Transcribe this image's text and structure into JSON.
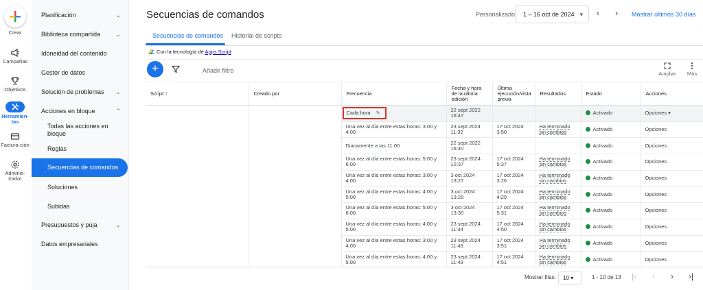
{
  "rail": {
    "create": "Crear",
    "items": [
      "Campañas",
      "Objetivos",
      "Herramien-tas",
      "Factura-ción",
      "Adminis-trador"
    ]
  },
  "sidenav": {
    "items": [
      {
        "label": "Planificación"
      },
      {
        "label": "Biblioteca compartida"
      },
      {
        "label": "Idoneidad del contenido"
      },
      {
        "label": "Gestor de datos"
      },
      {
        "label": "Solución de problemas"
      },
      {
        "label": "Acciones en bloque"
      },
      {
        "label": "Todas las acciones en bloque"
      },
      {
        "label": "Reglas"
      },
      {
        "label": "Secuencias de comandos"
      },
      {
        "label": "Soluciones"
      },
      {
        "label": "Subidas"
      },
      {
        "label": "Presupuestos y puja"
      },
      {
        "label": "Datos empresariales"
      }
    ]
  },
  "header": {
    "title": "Secuencias de comandos",
    "period_label": "Personalizado",
    "date_range": "1 – 16 oct de 2024",
    "show_last": "Mostrar últimos 30 días"
  },
  "tabs": [
    "Secuencias de comandos",
    "Historial de scripts"
  ],
  "powered": {
    "prefix": "Con la tecnología de",
    "link": "Apps Script"
  },
  "toolbar": {
    "add_filter": "Añadir filtro",
    "expand": "Ampliar",
    "more": "Más"
  },
  "table": {
    "columns": [
      "Script",
      "Creado por",
      "Frecuencia",
      "Fecha y hora de la última edición",
      "Última ejecución/vista previa",
      "Resultados",
      "Estado",
      "Acciones"
    ],
    "rows": [
      {
        "freq": "Cada hora",
        "edited": "22 sept 2022 16:47",
        "last_run": "",
        "result": "",
        "status": "Activado",
        "action": "Opciones"
      },
      {
        "freq": "Una vez al día entre estas horas: 3:00 y 4:00",
        "edited": "23 sept 2024 11:32",
        "last_run": "17 oct 2024 3:50",
        "result": "Ha terminado sin cambios",
        "status": "Activado",
        "action": "Opciones"
      },
      {
        "freq": "Diariamente a las 11:00",
        "edited": "22 sept 2022 16:40",
        "last_run": "",
        "result": "",
        "status": "Activado",
        "action": "Opciones"
      },
      {
        "freq": "Una vez al día entre estas horas: 5:00 y 6:00",
        "edited": "23 sept 2024 12:37",
        "last_run": "17 oct 2024 5:37",
        "result": "Ha terminado sin cambios",
        "status": "Activado",
        "action": "Opciones"
      },
      {
        "freq": "Una vez al día entre estas horas: 3:00 y 4:00",
        "edited": "3 oct 2024 13:27",
        "last_run": "17 oct 2024 3:26",
        "result": "Ha terminado sin cambios",
        "status": "Activado",
        "action": "Opciones"
      },
      {
        "freq": "Una vez al día entre estas horas: 4:00 y 5:00",
        "edited": "3 oct 2024 13:28",
        "last_run": "17 oct 2024 4:29",
        "result": "Ha terminado sin cambios",
        "status": "Activado",
        "action": "Opciones"
      },
      {
        "freq": "Una vez al día entre estas horas: 5:00 y 6:00",
        "edited": "3 oct 2024 13:30",
        "last_run": "17 oct 2024 5:31",
        "result": "Ha terminado sin cambios",
        "status": "Activado",
        "action": "Opciones"
      },
      {
        "freq": "Una vez al día entre estas horas: 4:00 y 5:00",
        "edited": "23 sept 2024 11:34",
        "last_run": "17 oct 2024 4:50",
        "result": "Ha terminado sin cambios",
        "status": "Activado",
        "action": "Opciones"
      },
      {
        "freq": "Una vez al día entre estas horas: 3:00 y 4:00",
        "edited": "23 sept 2024 11:43",
        "last_run": "17 oct 2024 3:51",
        "result": "Ha terminado sin cambios",
        "status": "Activado",
        "action": "Opciones"
      },
      {
        "freq": "Una vez al día entre estas horas: 4:00 y 5:00",
        "edited": "23 sept 2024 11:49",
        "last_run": "17 oct 2024 4:51",
        "result": "Ha terminado sin cambios",
        "status": "Activado",
        "action": "Opciones"
      }
    ]
  },
  "pager": {
    "rows_label": "Mostrar filas:",
    "rows_value": "10",
    "range": "1 - 10 de 13"
  },
  "colors": {
    "accent": "#1a73e8",
    "active_status": "#1e8e3e",
    "highlight": "#d93025"
  }
}
